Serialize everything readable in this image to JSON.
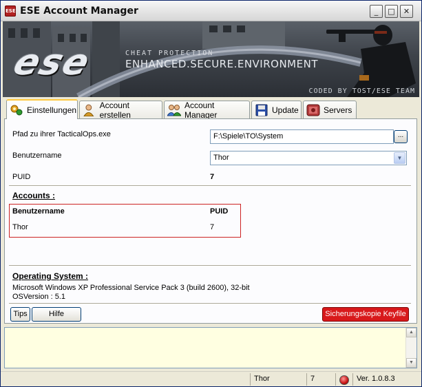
{
  "window": {
    "title": "ESE Account Manager",
    "icon_text": "ESE",
    "controls": [
      "_",
      "□",
      "✕"
    ]
  },
  "banner": {
    "logo": "ese",
    "small_text": "CHEAT PROTECTION",
    "big_text": "ENHANCED.SECURE.ENVIRONMENT",
    "credit": "CODED BY TOST/ESE TEAM"
  },
  "tabs": [
    {
      "label": "Einstellungen",
      "icon": "settings-icon"
    },
    {
      "label": "Account erstellen",
      "icon": "user-add-icon"
    },
    {
      "label": "Account Manager",
      "icon": "users-icon"
    },
    {
      "label": "Update",
      "icon": "floppy-icon"
    },
    {
      "label": "Servers",
      "icon": "server-icon"
    }
  ],
  "settings": {
    "path_label": "Pfad zu ihrer TacticalOps.exe",
    "path_value": "F:\\Spiele\\TO\\System",
    "browse_label": "...",
    "username_label": "Benutzername",
    "username_value": "Thor",
    "puid_label": "PUID",
    "puid_value": "7"
  },
  "accounts": {
    "title": "Accounts :",
    "header_user": "Benutzername",
    "header_puid": "PUID",
    "rows": [
      {
        "user": "Thor",
        "puid": "7"
      }
    ]
  },
  "os": {
    "title": "Operating System :",
    "line1": "Microsoft Windows XP Professional Service Pack 3 (build 2600), 32-bit",
    "line2": "OSVersion : 5.1"
  },
  "buttons": {
    "tips": "Tips",
    "hilfe": "Hilfe",
    "backup": "Sicherungskopie Keyfile"
  },
  "statusbar": {
    "user": "Thor",
    "puid": "7",
    "version": "Ver. 1.0.8.3"
  },
  "colors": {
    "accent_red": "#d8191b",
    "highlight_box": "#cc2222",
    "log_bg": "#ffffe1",
    "active_tab_marker": "#ffc83c"
  }
}
